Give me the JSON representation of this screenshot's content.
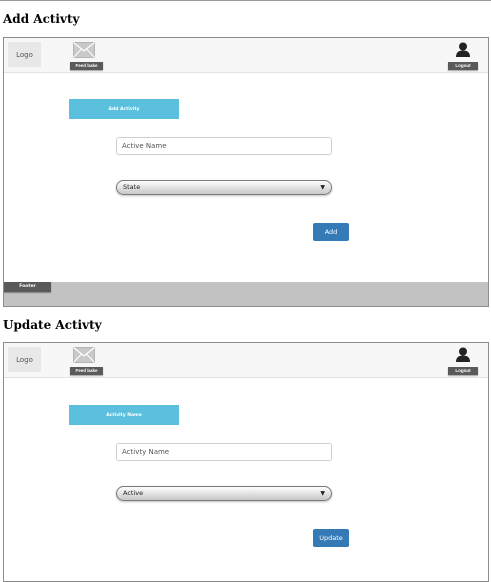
{
  "sections": [
    {
      "title": "Add Activty",
      "header": {
        "logo": "Logo",
        "feedback_label": "Feed bake",
        "logout_label": "Logout"
      },
      "form_heading": "Add Activity",
      "name_input": {
        "placeholder": "Active Name",
        "value": ""
      },
      "select": {
        "selected": "State"
      },
      "submit_label": "Add",
      "footer_label": "Footer"
    },
    {
      "title": "Update Activty",
      "header": {
        "logo": "Logo",
        "feedback_label": "Feed bake",
        "logout_label": "Logout"
      },
      "form_heading": "Activity Name",
      "name_input": {
        "placeholder": "Activty Name",
        "value": ""
      },
      "select": {
        "selected": "Active"
      },
      "submit_label": "Update"
    }
  ],
  "icons": {
    "feedback": "mail-icon",
    "account": "user-icon",
    "select_caret": "caret-down-icon"
  },
  "colors": {
    "heading_bar": "#5bc0de",
    "primary_button": "#337ab7",
    "dark_badge": "#5a5a5a",
    "footer": "#c2c2c2",
    "header_bg": "#f7f7f7"
  }
}
